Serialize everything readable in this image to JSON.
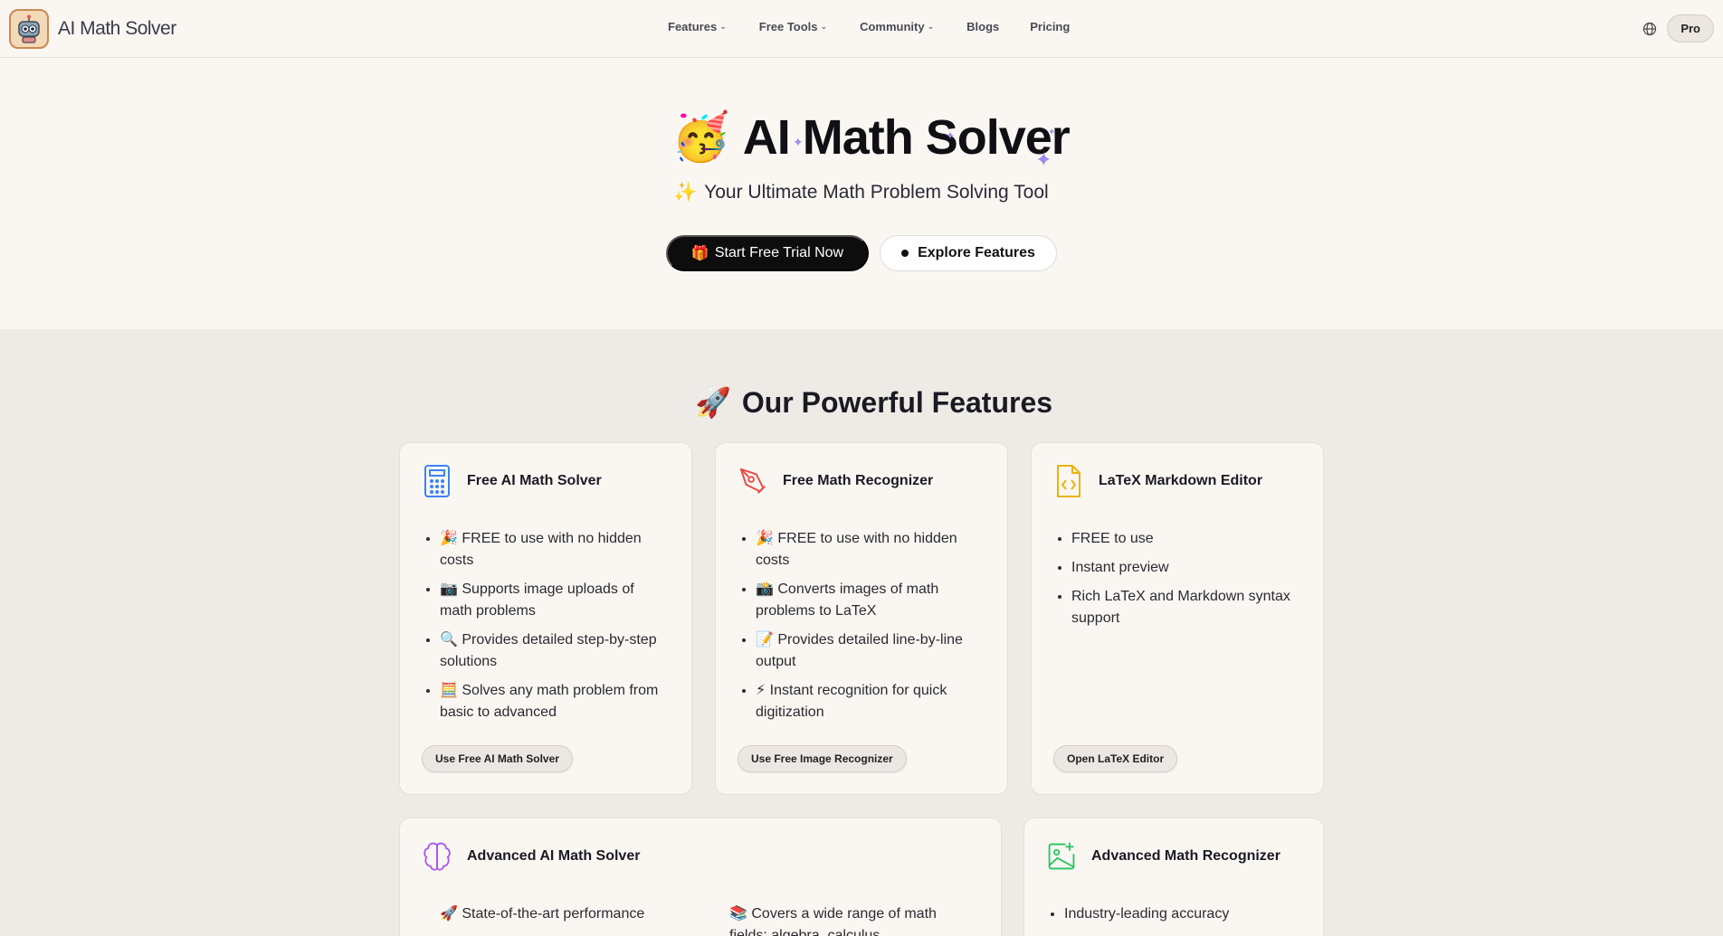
{
  "brand": {
    "name": "AI Math Solver"
  },
  "nav": {
    "items": [
      {
        "label": "Features",
        "has_dropdown": true
      },
      {
        "label": "Free Tools",
        "has_dropdown": true
      },
      {
        "label": "Community",
        "has_dropdown": true
      },
      {
        "label": "Blogs",
        "has_dropdown": false
      },
      {
        "label": "Pricing",
        "has_dropdown": false
      }
    ],
    "pro_label": "Pro",
    "language_icon": "globe-icon"
  },
  "hero": {
    "emoji": "🥳",
    "title": "AI Math Solver",
    "subtitle_emoji": "✨",
    "subtitle": "Your Ultimate Math Problem Solving Tool",
    "cta_primary_emoji": "🎁",
    "cta_primary": "Start Free Trial Now",
    "cta_secondary": "Explore Features"
  },
  "features": {
    "emoji": "🚀",
    "title": "Our Powerful Features",
    "cards": [
      {
        "title": "Free AI Math Solver",
        "icon": "calculator-icon",
        "icon_color": "#3b82f6",
        "items": [
          "🎉 FREE to use with no hidden costs",
          "📷 Supports image uploads of math problems",
          "🔍 Provides detailed step-by-step solutions",
          "🧮 Solves any math problem from basic to advanced"
        ],
        "button": "Use Free AI Math Solver"
      },
      {
        "title": "Free Math Recognizer",
        "icon": "pen-tool-icon",
        "icon_color": "#ef4444",
        "items": [
          "🎉 FREE to use with no hidden costs",
          "📸 Converts images of math problems to LaTeX",
          "📝 Provides detailed line-by-line output",
          "⚡ Instant recognition for quick digitization"
        ],
        "button": "Use Free Image Recognizer"
      },
      {
        "title": "LaTeX Markdown Editor",
        "icon": "file-code-icon",
        "icon_color": "#eab308",
        "items": [
          "FREE to use",
          "Instant preview",
          "Rich LaTeX and Markdown syntax support"
        ],
        "button": "Open LaTeX Editor"
      },
      {
        "title": "Advanced AI Math Solver",
        "icon": "brain-icon",
        "icon_color": "#a855f7",
        "items": [
          "🚀 State-of-the-art performance",
          "📚 Covers a wide range of math fields: algebra, calculus"
        ]
      },
      {
        "title": "Advanced Math Recognizer",
        "icon": "image-plus-icon",
        "icon_color": "#22c55e",
        "items": [
          "Industry-leading accuracy"
        ]
      }
    ]
  }
}
